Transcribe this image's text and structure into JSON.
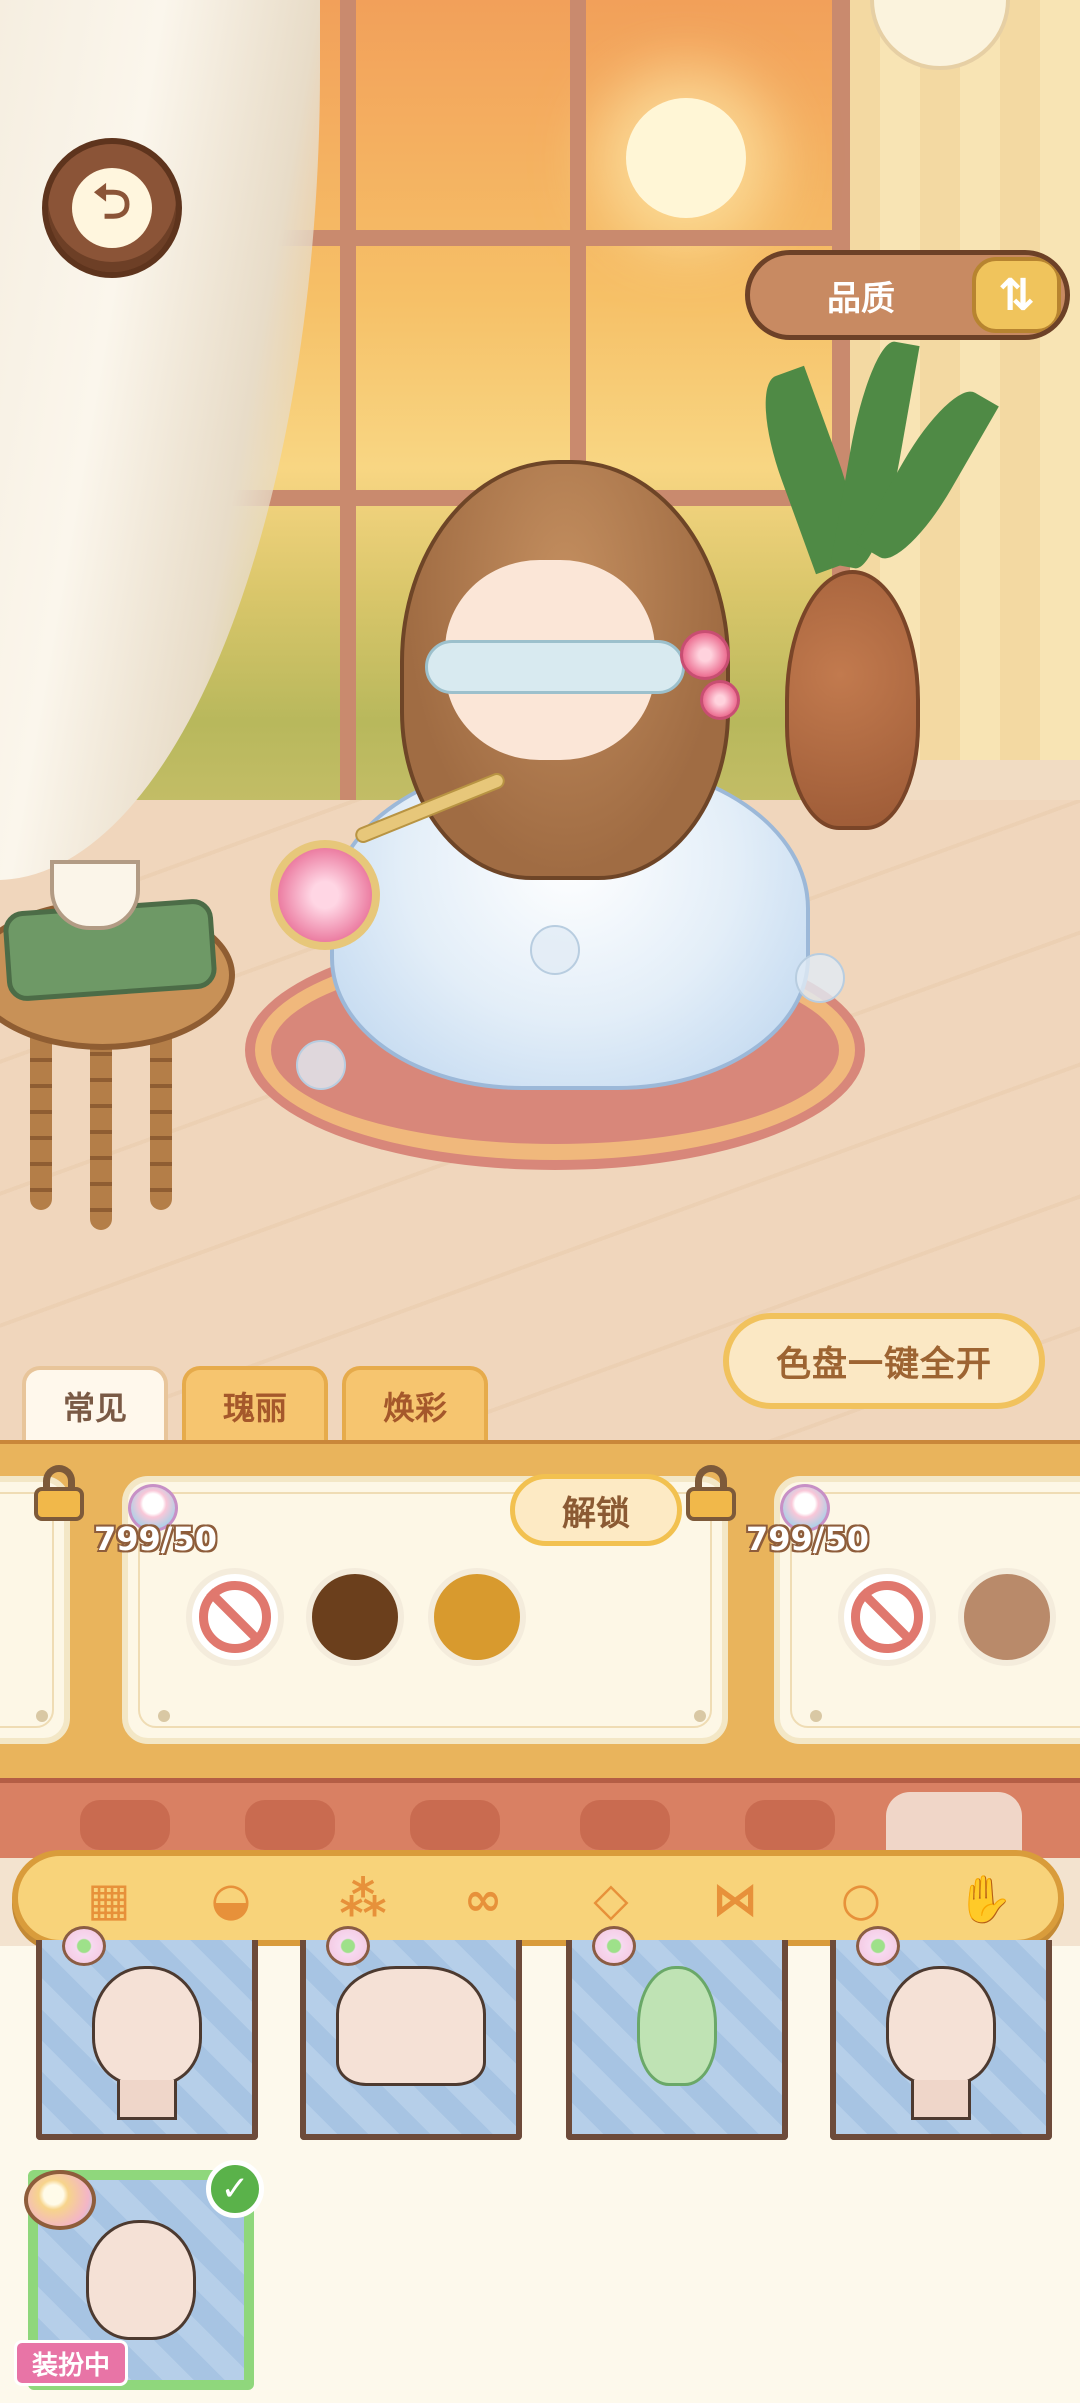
{
  "header": {
    "back_icon": "back-arrow-icon",
    "quality_label": "品质",
    "quality_icon": "sort-icon"
  },
  "actions": {
    "palette_open_all": "色盘一键全开"
  },
  "tabs": [
    {
      "label": "常见",
      "active": true
    },
    {
      "label": "瑰丽",
      "active": false
    },
    {
      "label": "焕彩",
      "active": false
    }
  ],
  "palette_cards": [
    {
      "cost": "799/50",
      "unlock_label": "解锁",
      "locked": true,
      "colors": [
        "none",
        "#6b3f1c",
        "#d89a2e"
      ]
    },
    {
      "cost": "799/50",
      "locked": true,
      "colors": [
        "none",
        "#b98a6a"
      ]
    }
  ],
  "categories": {
    "main": [
      "eyes-icon",
      "top-icon",
      "dress-icon",
      "pants-icon",
      "shoes-icon",
      "accessory-icon"
    ],
    "sub": [
      "grid-icon",
      "hat-icon",
      "earring-icon",
      "glasses-icon",
      "necklace-icon",
      "bow-icon",
      "bracelet-icon",
      "glove-icon"
    ]
  },
  "items": [
    {
      "name": "headpiece-bonnet"
    },
    {
      "name": "shoulder-piece"
    },
    {
      "name": "green-ribbon"
    },
    {
      "name": "hair-clip"
    }
  ],
  "equipped_item": {
    "name": "blindfold",
    "badge": "装扮中"
  },
  "colors": {
    "accent": "#f1c25d",
    "brown": "#8b5437",
    "equipped_green": "#8fd77c",
    "badge_pink": "#e874a6"
  }
}
